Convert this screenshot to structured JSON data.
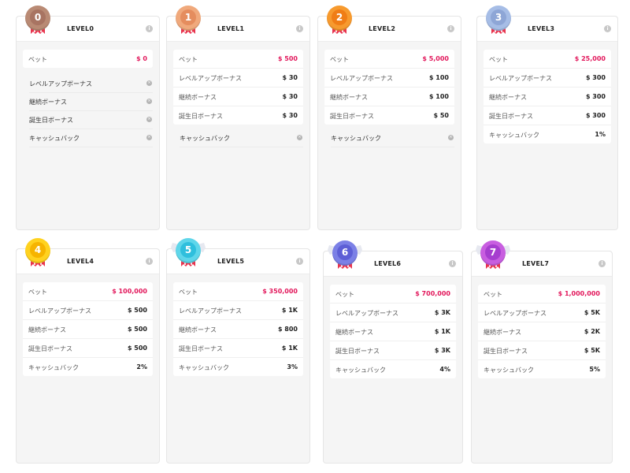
{
  "labels": {
    "bet": "ベット",
    "levelup": "レベルアップボーナス",
    "continuation": "継続ボーナス",
    "birthday": "誕生日ボーナス",
    "cashback": "キャッシュバック"
  },
  "info_icon_glyph": "i",
  "unavailable_icon_glyph": "×",
  "levels": [
    {
      "title": "LEVEL0",
      "badge": "0",
      "medal_color": "#b98a74",
      "medal_inner": "#a87462",
      "bet": "$ 0",
      "levelup": null,
      "continuation": null,
      "birthday": null,
      "cashback": null
    },
    {
      "title": "LEVEL1",
      "badge": "1",
      "medal_color": "#f0a97c",
      "medal_inner": "#e58d5e",
      "bet": "$ 500",
      "levelup": "$ 30",
      "continuation": "$ 30",
      "birthday": "$ 30",
      "cashback": null
    },
    {
      "title": "LEVEL2",
      "badge": "2",
      "medal_color": "#f79a2e",
      "medal_inner": "#f07d16",
      "bet": "$ 5,000",
      "levelup": "$ 100",
      "continuation": "$ 100",
      "birthday": "$ 50",
      "cashback": null
    },
    {
      "title": "LEVEL3",
      "badge": "3",
      "medal_color": "#a6bde6",
      "medal_inner": "#8ea6d6",
      "bet": "$ 25,000",
      "levelup": "$ 300",
      "continuation": "$ 300",
      "birthday": "$ 300",
      "cashback": "1%"
    },
    {
      "title": "LEVEL4",
      "badge": "4",
      "medal_color": "#ffd21f",
      "medal_inner": "#f6b400",
      "bet": "$ 100,000",
      "levelup": "$ 500",
      "continuation": "$ 500",
      "birthday": "$ 500",
      "cashback": "2%"
    },
    {
      "title": "LEVEL5",
      "badge": "5",
      "medal_color": "#5fd6ea",
      "medal_inner": "#2fbfdd",
      "bet": "$ 350,000",
      "levelup": "$ 1K",
      "continuation": "$ 800",
      "birthday": "$ 1K",
      "cashback": "3%"
    },
    {
      "title": "LEVEL6",
      "badge": "6",
      "medal_color": "#7b80e6",
      "medal_inner": "#5d5fd6",
      "bet": "$ 700,000",
      "levelup": "$ 3K",
      "continuation": "$ 1K",
      "birthday": "$ 3K",
      "cashback": "4%"
    },
    {
      "title": "LEVEL7",
      "badge": "7",
      "medal_color": "#c85ee0",
      "medal_inner": "#a63ecf",
      "bet": "$ 1,000,000",
      "levelup": "$ 5K",
      "continuation": "$ 2K",
      "birthday": "$ 5K",
      "cashback": "5%"
    }
  ],
  "colors": {
    "bet_value": "#e2175b",
    "ribbon_red": "#e8344e",
    "ribbon_light": "#ffd9df"
  }
}
